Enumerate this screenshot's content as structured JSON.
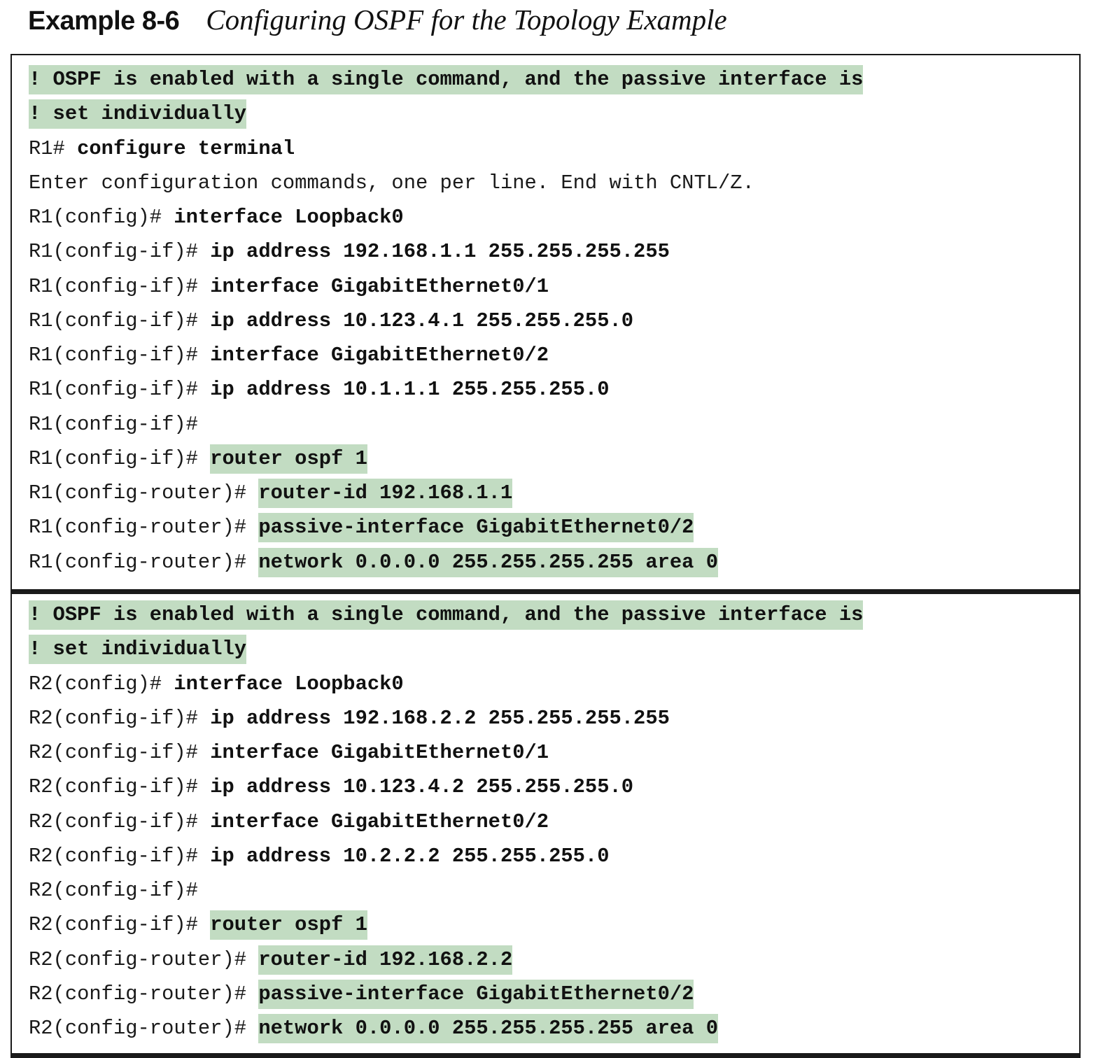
{
  "header": {
    "label": "Example 8-6",
    "title": "Configuring OSPF for the Topology Example"
  },
  "colors": {
    "highlight": "#c2dcc2",
    "text": "#1a1a1a",
    "border": "#1a1a1a"
  },
  "sections": [
    {
      "lines": [
        {
          "prompt": "",
          "command": "! OSPF is enabled with a single command, and the passive interface is",
          "bold": true,
          "highlight": true
        },
        {
          "prompt": "",
          "command": "! set individually",
          "bold": true,
          "highlight": true
        },
        {
          "prompt": "R1# ",
          "command": "configure terminal",
          "bold": true,
          "highlight": false
        },
        {
          "prompt": "Enter configuration commands, one per line. End with CNTL/Z.",
          "command": "",
          "bold": false,
          "highlight": false
        },
        {
          "prompt": "R1(config)# ",
          "command": "interface Loopback0",
          "bold": true,
          "highlight": false
        },
        {
          "prompt": "R1(config-if)# ",
          "command": "ip address 192.168.1.1 255.255.255.255",
          "bold": true,
          "highlight": false
        },
        {
          "prompt": "R1(config-if)# ",
          "command": "interface GigabitEthernet0/1",
          "bold": true,
          "highlight": false
        },
        {
          "prompt": "R1(config-if)# ",
          "command": "ip address 10.123.4.1 255.255.255.0",
          "bold": true,
          "highlight": false
        },
        {
          "prompt": "R1(config-if)# ",
          "command": "interface GigabitEthernet0/2",
          "bold": true,
          "highlight": false
        },
        {
          "prompt": "R1(config-if)# ",
          "command": "ip address 10.1.1.1 255.255.255.0",
          "bold": true,
          "highlight": false
        },
        {
          "prompt": "R1(config-if)#",
          "command": "",
          "bold": false,
          "highlight": false
        },
        {
          "prompt": "R1(config-if)# ",
          "command": "router ospf 1",
          "bold": true,
          "highlight": true
        },
        {
          "prompt": "R1(config-router)# ",
          "command": "router-id 192.168.1.1",
          "bold": true,
          "highlight": true
        },
        {
          "prompt": "R1(config-router)# ",
          "command": "passive-interface GigabitEthernet0/2",
          "bold": true,
          "highlight": true
        },
        {
          "prompt": "R1(config-router)# ",
          "command": "network 0.0.0.0 255.255.255.255 area 0",
          "bold": true,
          "highlight": true
        }
      ]
    },
    {
      "lines": [
        {
          "prompt": "",
          "command": "! OSPF is enabled with a single command, and the passive interface is",
          "bold": true,
          "highlight": true
        },
        {
          "prompt": "",
          "command": "! set individually",
          "bold": true,
          "highlight": true
        },
        {
          "prompt": "R2(config)# ",
          "command": "interface Loopback0",
          "bold": true,
          "highlight": false
        },
        {
          "prompt": "R2(config-if)# ",
          "command": "ip address 192.168.2.2 255.255.255.255",
          "bold": true,
          "highlight": false
        },
        {
          "prompt": "R2(config-if)# ",
          "command": "interface GigabitEthernet0/1",
          "bold": true,
          "highlight": false
        },
        {
          "prompt": "R2(config-if)# ",
          "command": "ip address 10.123.4.2 255.255.255.0",
          "bold": true,
          "highlight": false
        },
        {
          "prompt": "R2(config-if)# ",
          "command": "interface GigabitEthernet0/2",
          "bold": true,
          "highlight": false
        },
        {
          "prompt": "R2(config-if)# ",
          "command": "ip address 10.2.2.2 255.255.255.0",
          "bold": true,
          "highlight": false
        },
        {
          "prompt": "R2(config-if)#",
          "command": "",
          "bold": false,
          "highlight": false
        },
        {
          "prompt": "R2(config-if)# ",
          "command": "router ospf 1",
          "bold": true,
          "highlight": true
        },
        {
          "prompt": "R2(config-router)# ",
          "command": "router-id 192.168.2.2",
          "bold": true,
          "highlight": true
        },
        {
          "prompt": "R2(config-router)# ",
          "command": "passive-interface GigabitEthernet0/2",
          "bold": true,
          "highlight": true
        },
        {
          "prompt": "R2(config-router)# ",
          "command": "network 0.0.0.0 255.255.255.255 area 0",
          "bold": true,
          "highlight": true
        }
      ]
    }
  ]
}
